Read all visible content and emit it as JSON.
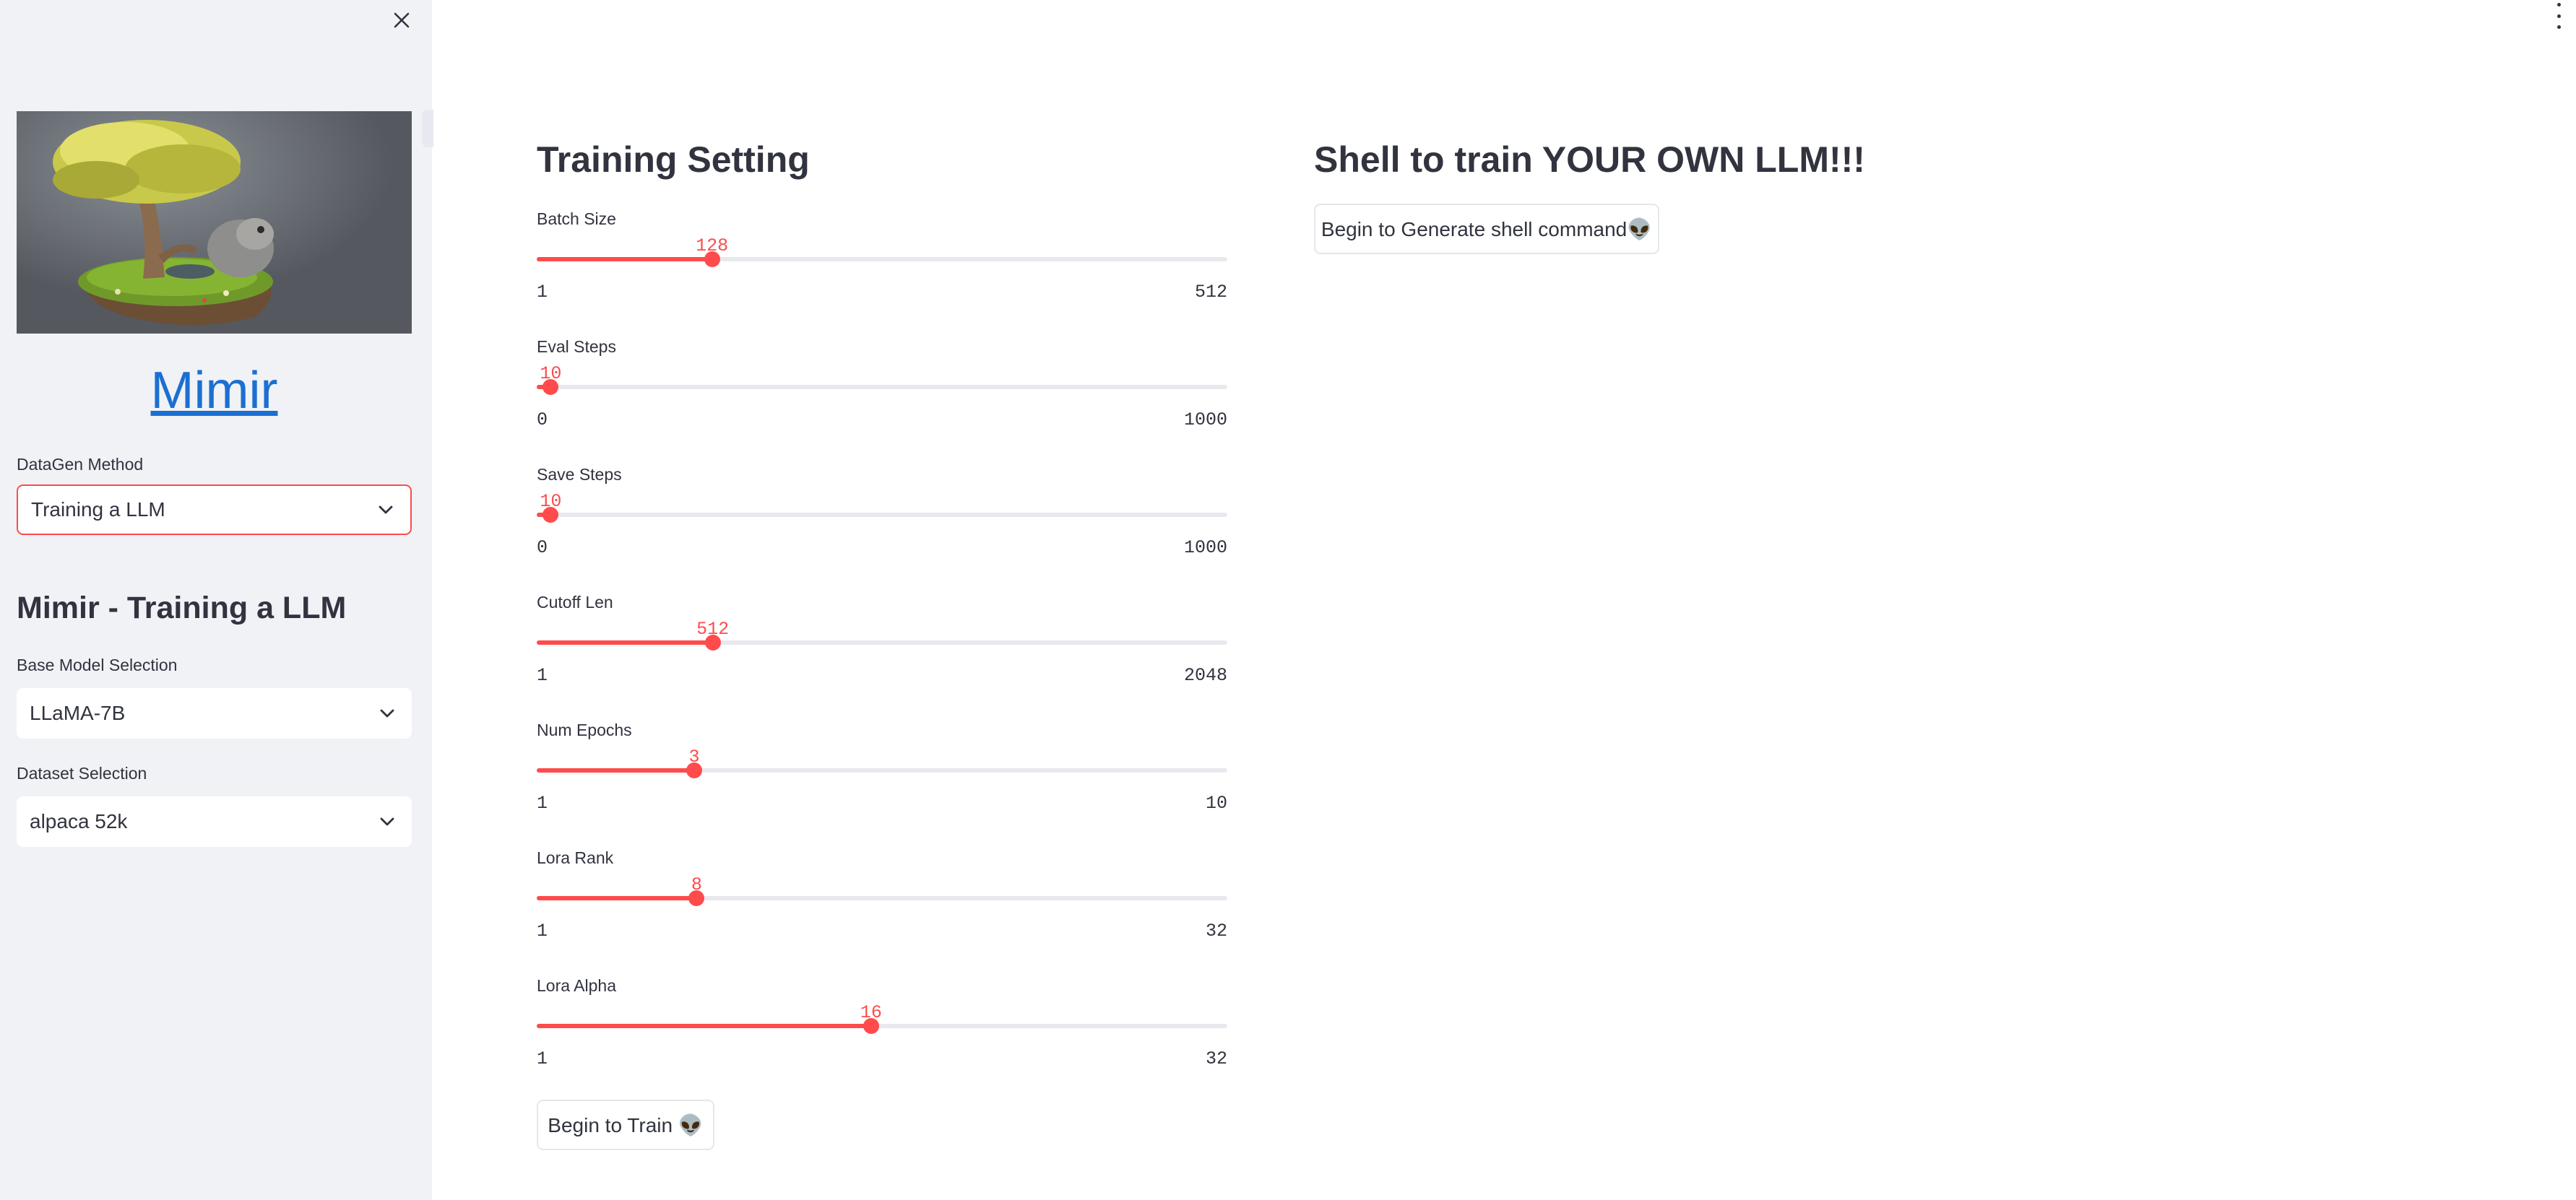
{
  "sidebar": {
    "app_title": "Mimir",
    "datagen": {
      "label": "DataGen Method",
      "value": "Training a LLM"
    },
    "section_title": "Mimir - Training a LLM",
    "base_model": {
      "label": "Base Model Selection",
      "value": "LLaMA-7B"
    },
    "dataset": {
      "label": "Dataset Selection",
      "value": "alpaca 52k"
    },
    "icons": {
      "close": "close-icon",
      "dropdown": "chevron-down-icon",
      "hero": "floating-island-tree-image"
    }
  },
  "main": {
    "training_heading": "Training Setting",
    "shell_heading": "Shell to train YOUR OWN LLM!!!",
    "generate_button": "Begin to Generate shell command👽",
    "train_button": "Begin to Train 👽",
    "menu_icon": "kebab-menu-icon",
    "sliders": [
      {
        "label": "Batch Size",
        "value": 128,
        "min": 1,
        "max": 512
      },
      {
        "label": "Eval Steps",
        "value": 10,
        "min": 0,
        "max": 1000
      },
      {
        "label": "Save Steps",
        "value": 10,
        "min": 0,
        "max": 1000
      },
      {
        "label": "Cutoff Len",
        "value": 512,
        "min": 1,
        "max": 2048
      },
      {
        "label": "Num Epochs",
        "value": 3,
        "min": 1,
        "max": 10
      },
      {
        "label": "Lora Rank",
        "value": 8,
        "min": 1,
        "max": 32
      },
      {
        "label": "Lora Alpha",
        "value": 16,
        "min": 1,
        "max": 32
      }
    ]
  },
  "colors": {
    "accent": "#ff4b4b",
    "link": "#1c6fd2",
    "sidebar_bg": "#f0f2f6",
    "text": "#31333f"
  }
}
